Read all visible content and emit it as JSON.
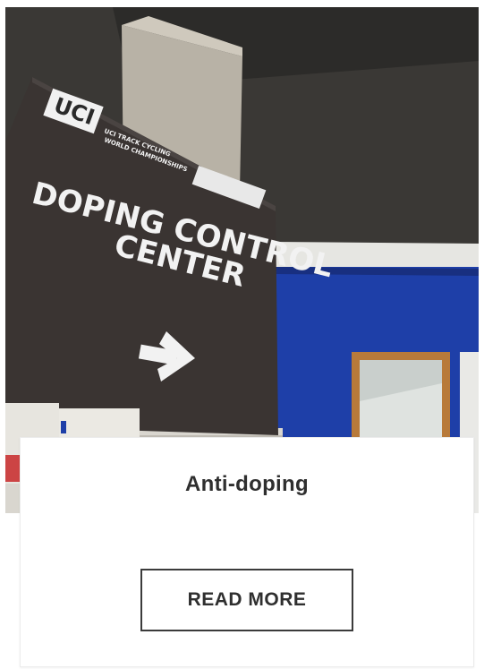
{
  "card": {
    "image": {
      "sign_lines": [
        "DOPING CONTROL",
        "CENTER"
      ],
      "logo_text": "UCI",
      "logo_subtext": [
        "UCI TRACK CYCLING",
        "WORLD CHAMPIONSHIPS"
      ],
      "arrow_icon": "right-arrow-icon"
    },
    "title": "Anti-doping",
    "button_label": "READ MORE"
  },
  "colors": {
    "wall_blue": "#1e3fa8",
    "sign_dark": "#3a3432",
    "ceiling": "#2f2e2c",
    "button_border": "#3b3b3b"
  }
}
